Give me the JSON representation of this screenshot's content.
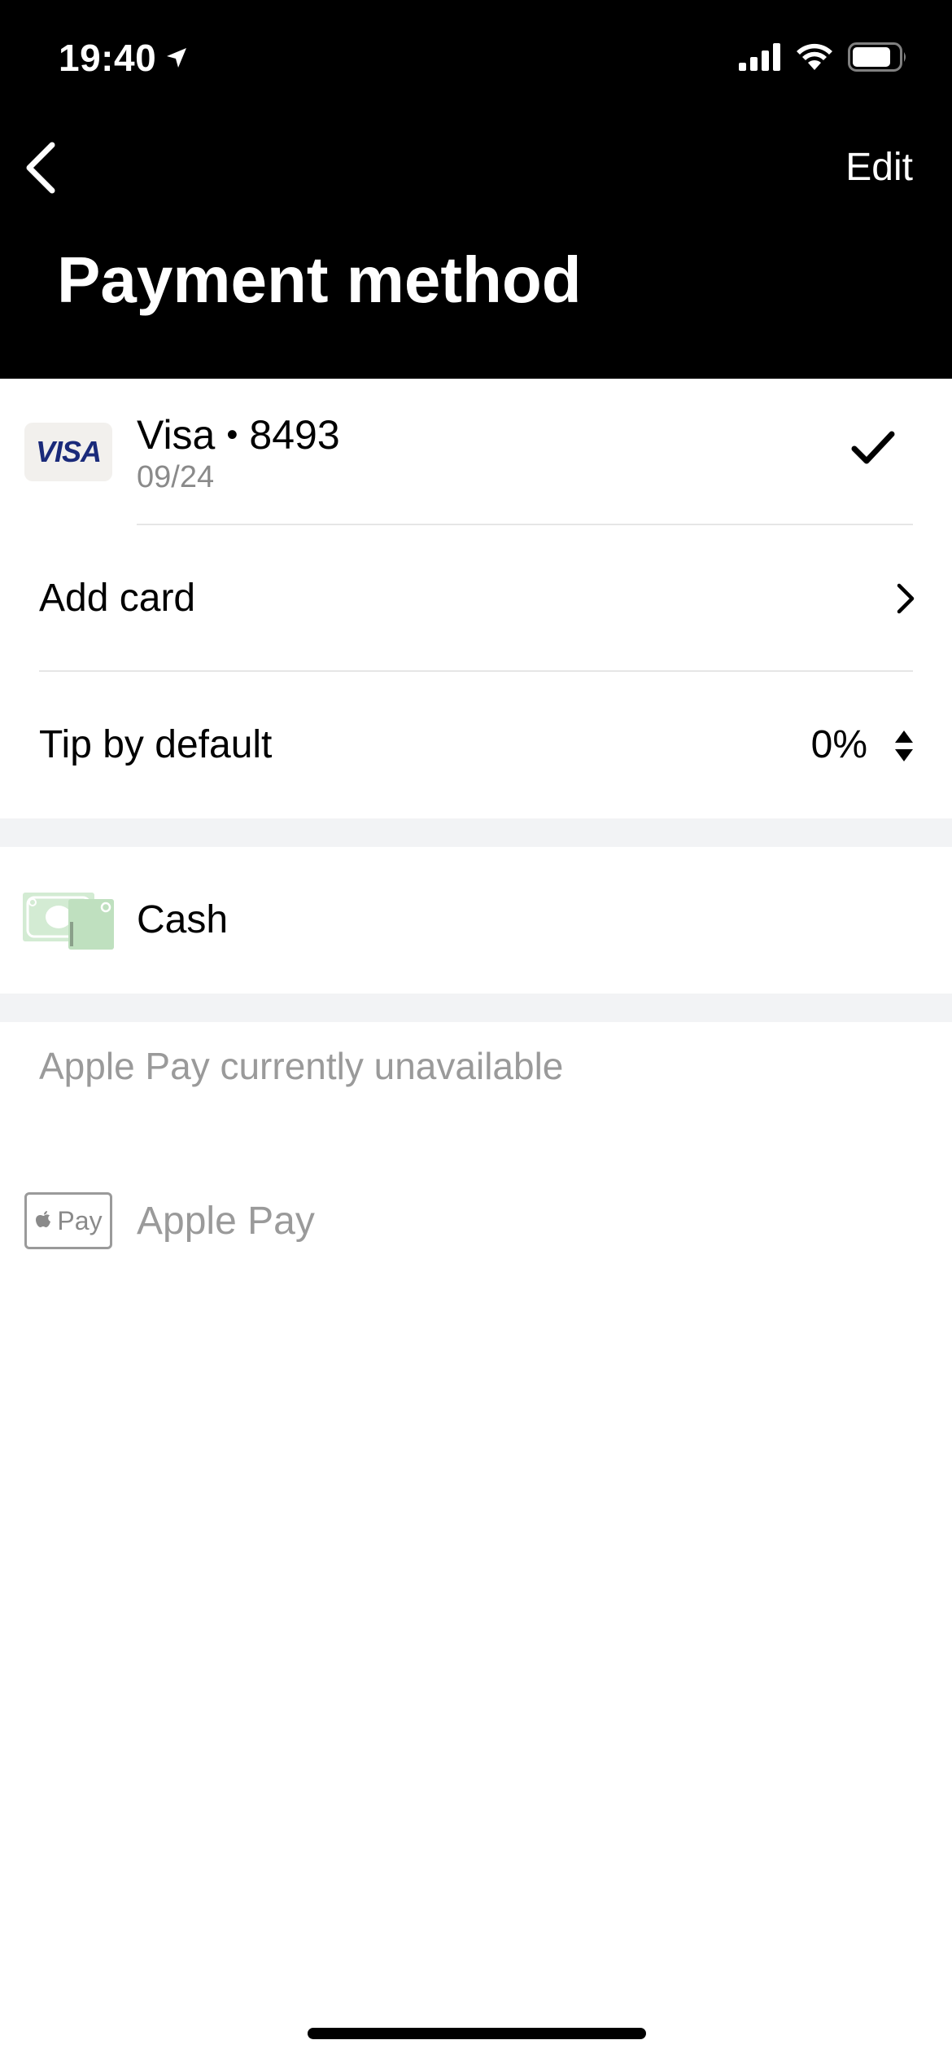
{
  "status_bar": {
    "time": "19:40",
    "icons": [
      "location-arrow-icon",
      "signal-icon",
      "wifi-icon",
      "battery-icon"
    ]
  },
  "header": {
    "back_icon": "chevron-left-icon",
    "edit_label": "Edit",
    "title": "Payment method"
  },
  "card": {
    "logo_text": "VISA",
    "brand": "Visa",
    "separator": "•",
    "last4": "8493",
    "expiry": "09/24",
    "selected": true
  },
  "add_card": {
    "label": "Add card"
  },
  "tip": {
    "label": "Tip by default",
    "value": "0%"
  },
  "cash": {
    "label": "Cash"
  },
  "apple_pay": {
    "note": "Apple Pay currently unavailable",
    "logo_text": "Pay",
    "label": "Apple Pay"
  },
  "colors": {
    "header_bg": "#000000",
    "muted_text": "#9a9a9a",
    "section_gap": "#f2f3f5",
    "visa_blue": "#1a2a7a",
    "cash_green": "#cfe8cf"
  }
}
